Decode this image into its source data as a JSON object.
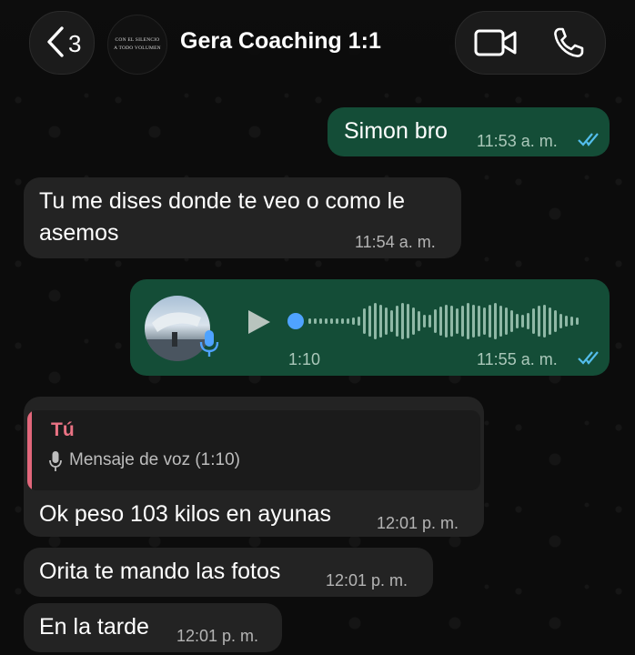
{
  "header": {
    "back_count": "3",
    "avatar_lines": [
      "CON EL SILENCIO",
      "A TODO VOLUMEN"
    ],
    "title": "Gera Coaching 1:1",
    "icons": {
      "back": "chevron-left-icon",
      "video": "video-camera-icon",
      "call": "phone-icon"
    }
  },
  "messages": [
    {
      "direction": "outgoing",
      "text": "Simon bro",
      "time": "11:53 a. m.",
      "status": "read"
    },
    {
      "direction": "incoming",
      "lines": [
        "Tu me dises donde te veo o como le",
        "asemos"
      ],
      "time": "11:54 a. m."
    },
    {
      "direction": "outgoing",
      "type": "voice",
      "duration": "1:10",
      "time": "11:55 a. m.",
      "status": "read"
    },
    {
      "direction": "incoming",
      "quote": {
        "author": "Tú",
        "text": "Mensaje de voz (1:10)"
      },
      "text": "Ok peso 103 kilos en ayunas",
      "time": "12:01 p. m."
    },
    {
      "direction": "incoming",
      "text": "Orita te mando las fotos",
      "time": "12:01 p. m."
    },
    {
      "direction": "incoming",
      "text": "En la tarde",
      "time": "12:01 p. m."
    }
  ],
  "colors": {
    "outgoing_bubble": "#144d37",
    "incoming_bubble": "#232323",
    "read_ticks": "#53bdeb",
    "quote_accent": "#e2677b"
  }
}
